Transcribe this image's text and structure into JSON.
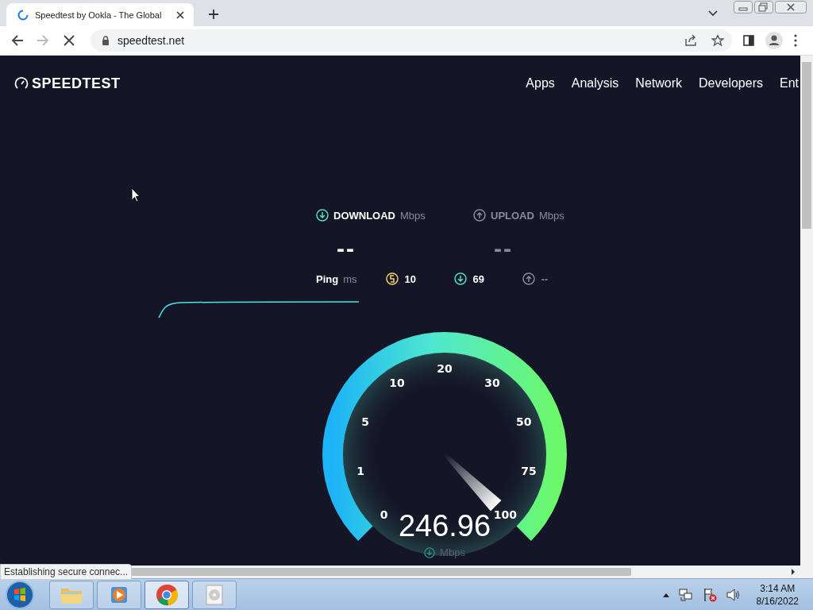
{
  "browser": {
    "tab": {
      "title": "Speedtest by Ookla - The Global",
      "loading": true
    },
    "address": "speedtest.net"
  },
  "site": {
    "logo": "SPEEDTEST",
    "nav": [
      "Apps",
      "Analysis",
      "Network",
      "Developers",
      "Ent"
    ]
  },
  "test": {
    "results": [
      {
        "kind": "download",
        "label": "DOWNLOAD",
        "unit": "Mbps",
        "value": "--",
        "active": true
      },
      {
        "kind": "upload",
        "label": "UPLOAD",
        "unit": "Mbps",
        "value": "--",
        "active": false
      }
    ],
    "ping": {
      "label": "Ping",
      "unit": "ms",
      "items": [
        {
          "kind": "jitter",
          "value": "10"
        },
        {
          "kind": "download",
          "value": "69"
        },
        {
          "kind": "upload",
          "value": "--"
        }
      ]
    },
    "gauge": {
      "ticks": [
        "0",
        "1",
        "5",
        "10",
        "20",
        "30",
        "50",
        "75",
        "100"
      ],
      "reading": "246.96",
      "unit": "Mbps"
    }
  },
  "status_text": "Establishing secure connec...",
  "taskbar": {
    "apps": [
      {
        "kind": "explorer",
        "selected": false
      },
      {
        "kind": "media",
        "selected": false
      },
      {
        "kind": "chrome",
        "selected": true
      },
      {
        "kind": "disc",
        "selected": false
      }
    ],
    "clock": {
      "time": "3:14 AM",
      "date": "8/16/2022"
    }
  }
}
